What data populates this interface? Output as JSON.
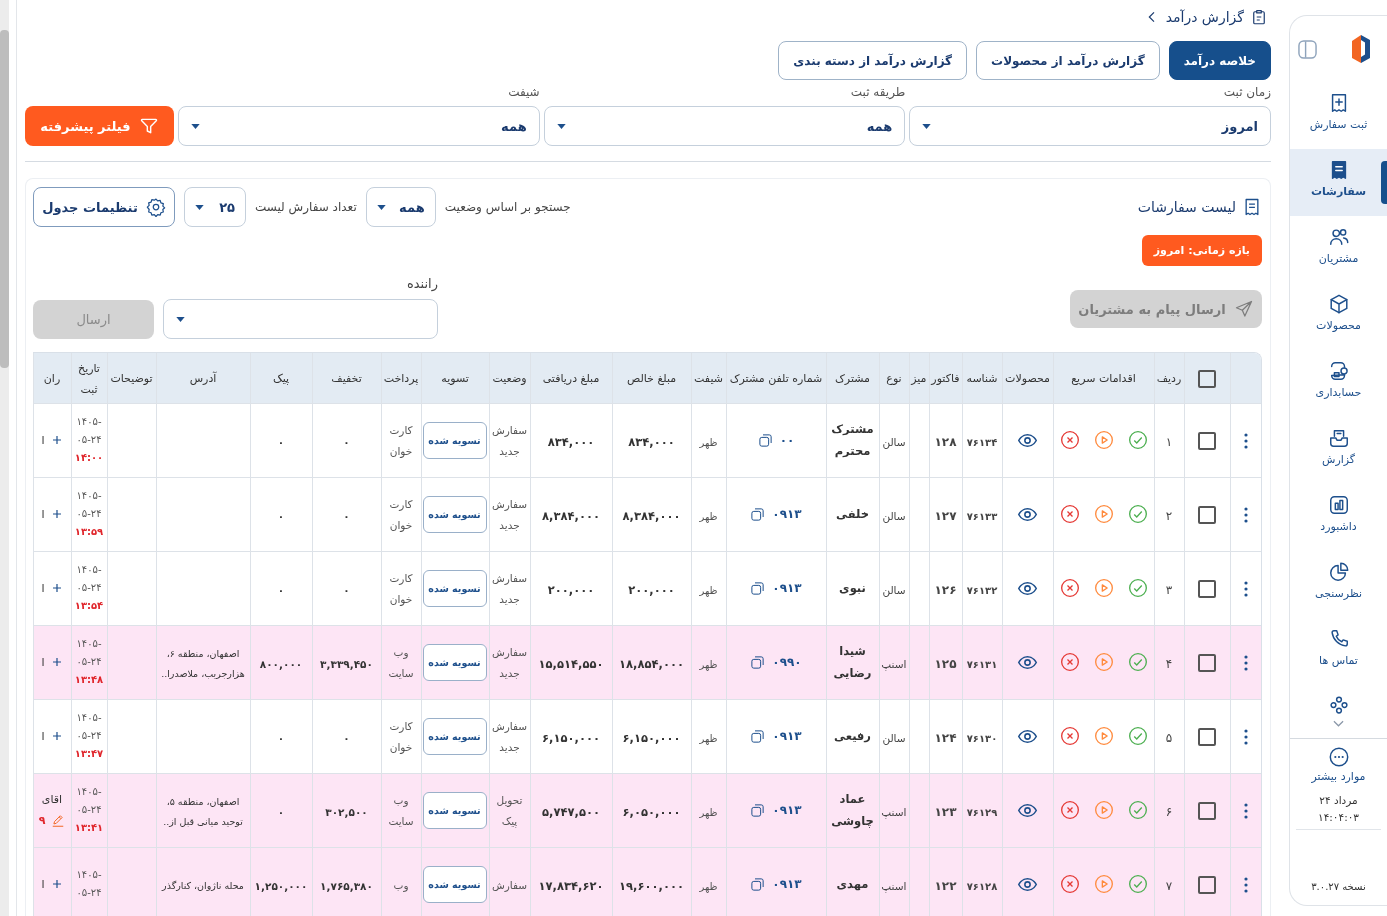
{
  "sidebar": {
    "items": [
      {
        "label": "ثبت سفارش",
        "selected": false
      },
      {
        "label": "سفارشات",
        "selected": true
      },
      {
        "label": "مشتریان",
        "selected": false
      },
      {
        "label": "محصولات",
        "selected": false
      },
      {
        "label": "حسابداری",
        "selected": false
      },
      {
        "label": "گزارش",
        "selected": false
      },
      {
        "label": "داشبورد",
        "selected": false
      },
      {
        "label": "نظرسنجی",
        "selected": false
      },
      {
        "label": "تماس ها",
        "selected": false
      }
    ],
    "more": "موارد بیشتر",
    "date": "۲۴ مرداد",
    "time": "۱۴:۰۴:۰۳",
    "version": "نسخه ۳.۰.۲۷"
  },
  "breadcrumb": {
    "title": "گزارش درآمد"
  },
  "tabs": [
    {
      "label": "خلاصه درآمد",
      "selected": true
    },
    {
      "label": "گزارش درآمد از محصولات",
      "selected": false
    },
    {
      "label": "گزارش درآمد از دسته بندی",
      "selected": false
    }
  ],
  "filters": [
    {
      "label": "زمان ثبت",
      "value": "امروز"
    },
    {
      "label": "طریقه ثبت",
      "value": "همه"
    },
    {
      "label": "شیفت",
      "value": "همه"
    }
  ],
  "advanced_filter_button": "فیلتر پیشرفته",
  "orders": {
    "title": "لیست سفارشات",
    "status_filter": {
      "label": "جستجو بر اساس وضعیت",
      "value": "همه"
    },
    "page_size": {
      "label": "تعداد سفارش لیست",
      "value": "۲۵"
    },
    "table_settings_button": "تنظیمات جدول",
    "period_badge": "بازه زمانی: امروز",
    "message_button": {
      "label": "ارسال پیام به مشتریان",
      "disabled": true
    },
    "driver": {
      "label": "راننده"
    },
    "send_button": {
      "label": "ارسال",
      "disabled": true
    },
    "table": {
      "select_all": false,
      "columns": [
        "ردیف",
        "اقدامات سریع",
        "محصولات",
        "شناسه",
        "فاکتور",
        "میز",
        "نوع",
        "مشترک",
        "شماره تلفن مشترک",
        "شیفت",
        "مبلغ خالص",
        "مبلغ دریافتی",
        "وضعیت",
        "تسویه",
        "پرداخت",
        "تخفیف",
        "پیک",
        "آدرس",
        "توضیحات",
        "تاریخ ثبت",
        "ران"
      ],
      "rows": [
        {
          "number": "۱",
          "selected": false,
          "highlighted": false,
          "id": "۷۶۱۳۴",
          "invoice": "۱۲۸",
          "type": "سالن",
          "customer": "مشترک محترم",
          "phone": "۰۰",
          "shift": "ظهر",
          "net_amount": "۸۳۴,۰۰۰",
          "received_amount": "۸۳۴,۰۰۰",
          "status": "سفارش جدید",
          "settlement": "تسویه شده",
          "payment": "کارت خوان",
          "discount": "۰",
          "courier": "۰",
          "date": "۱۴۰۵-۰۵-۲۴",
          "time": "۱۴:۰۰",
          "driver": {
            "assigned": false,
            "name": "ا"
          }
        },
        {
          "number": "۲",
          "selected": false,
          "highlighted": false,
          "id": "۷۶۱۳۳",
          "invoice": "۱۲۷",
          "type": "سالن",
          "customer": "خلفی",
          "phone": "۰۹۱۳",
          "shift": "ظهر",
          "net_amount": "۸,۳۸۴,۰۰۰",
          "received_amount": "۸,۳۸۴,۰۰۰",
          "status": "سفارش جدید",
          "settlement": "تسویه شده",
          "payment": "کارت خوان",
          "discount": "۰",
          "courier": "۰",
          "date": "۱۴۰۵-۰۵-۲۴",
          "time": "۱۳:۵۹",
          "driver": {
            "assigned": false,
            "name": "ا"
          }
        },
        {
          "number": "۳",
          "selected": false,
          "highlighted": false,
          "id": "۷۶۱۳۲",
          "invoice": "۱۲۶",
          "type": "سالن",
          "customer": "نبوی",
          "phone": "۰۹۱۳",
          "shift": "ظهر",
          "net_amount": "۲۰۰,۰۰۰",
          "received_amount": "۲۰۰,۰۰۰",
          "status": "سفارش جدید",
          "settlement": "تسویه شده",
          "payment": "کارت خوان",
          "discount": "۰",
          "courier": "۰",
          "date": "۱۴۰۵-۰۵-۲۴",
          "time": "۱۳:۵۴",
          "driver": {
            "assigned": false,
            "name": "ا"
          }
        },
        {
          "number": "۴",
          "selected": false,
          "highlighted": true,
          "id": "۷۶۱۳۱",
          "invoice": "۱۲۵",
          "type": "اسنپ",
          "customer": "شیدا رضایی",
          "phone": "۰۹۹۰",
          "shift": "ظهر",
          "net_amount": "۱۸,۸۵۴,۰۰۰",
          "received_amount": "۱۵,۵۱۴,۵۵۰",
          "status": "سفارش جدید",
          "settlement": "تسویه شده",
          "payment": "وب سایت",
          "discount": "۳,۳۳۹,۴۵۰",
          "courier": "۸۰۰,۰۰۰",
          "address": "اصفهان، منطقه ۶، هزارجریب، ملاصدرا..",
          "date": "۱۴۰۵-۰۵-۲۴",
          "time": "۱۳:۴۸",
          "driver": {
            "assigned": false,
            "name": "ا"
          }
        },
        {
          "number": "۵",
          "selected": false,
          "highlighted": false,
          "id": "۷۶۱۳۰",
          "invoice": "۱۲۴",
          "type": "سالن",
          "customer": "رفیعی",
          "phone": "۰۹۱۳",
          "shift": "ظهر",
          "net_amount": "۶,۱۵۰,۰۰۰",
          "received_amount": "۶,۱۵۰,۰۰۰",
          "status": "سفارش جدید",
          "settlement": "تسویه شده",
          "payment": "کارت خوان",
          "discount": "۰",
          "courier": "۰",
          "date": "۱۴۰۵-۰۵-۲۴",
          "time": "۱۳:۴۷",
          "driver": {
            "assigned": false,
            "name": "ا"
          }
        },
        {
          "number": "۶",
          "selected": false,
          "highlighted": true,
          "id": "۷۶۱۲۹",
          "invoice": "۱۲۳",
          "type": "اسنپ",
          "customer": "عماد چاوشی",
          "phone": "۰۹۱۳",
          "shift": "ظهر",
          "net_amount": "۶,۰۵۰,۰۰۰",
          "received_amount": "۵,۷۴۷,۵۰۰",
          "status": "تحویل پیک",
          "settlement": "تسویه شده",
          "payment": "وب سایت",
          "discount": "۳۰۲,۵۰۰",
          "courier": "۰",
          "address": "اصفهان، منطقه ۵، توحید میانی قبل از..",
          "date": "۱۴۰۵-۰۵-۲۴",
          "time": "۱۳:۴۱",
          "driver": {
            "assigned": true,
            "name": "اقای",
            "phone": "۹"
          }
        },
        {
          "number": "۷",
          "selected": false,
          "highlighted": true,
          "id": "۷۶۱۲۸",
          "invoice": "۱۲۲",
          "type": "اسنپ",
          "customer": "مهدی",
          "phone": "۰۹۱۳",
          "shift": "ظهر",
          "net_amount": "۱۹,۶۰۰,۰۰۰",
          "received_amount": "۱۷,۸۳۴,۶۲۰",
          "status": "سفارش",
          "settlement": "تسویه شده",
          "payment": "وب",
          "discount": "۱,۷۶۵,۳۸۰",
          "courier": "۱,۲۵۰,۰۰۰",
          "address": "محله ناژوان، کنارگذر",
          "date": "۱۴۰۵-۰۵-۲۴",
          "driver": {
            "assigned": false,
            "name": "ا"
          }
        }
      ]
    }
  }
}
